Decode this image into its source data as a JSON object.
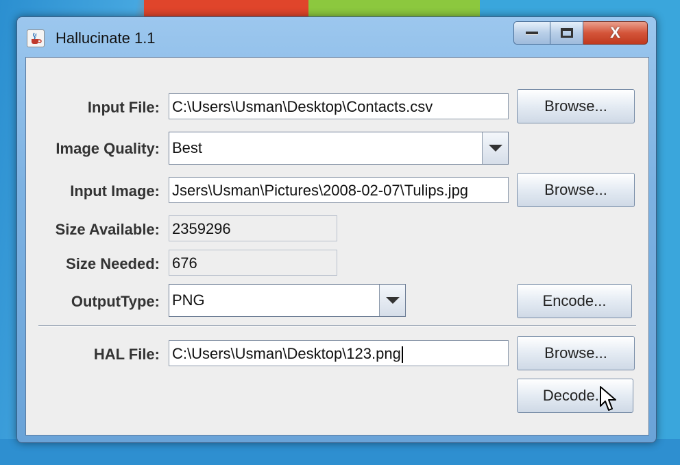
{
  "window": {
    "title": "Hallucinate 1.1",
    "controls": {
      "minimize": "minimize",
      "maximize": "maximize",
      "close": "X"
    }
  },
  "form": {
    "input_file": {
      "label": "Input File:",
      "value": "C:\\Users\\Usman\\Desktop\\Contacts.csv",
      "browse": "Browse..."
    },
    "image_quality": {
      "label": "Image Quality:",
      "selected": "Best"
    },
    "input_image": {
      "label": "Input Image:",
      "value": "Jsers\\Usman\\Pictures\\2008-02-07\\Tulips.jpg",
      "browse": "Browse..."
    },
    "size_available": {
      "label": "Size Available:",
      "value": "2359296"
    },
    "size_needed": {
      "label": "Size Needed:",
      "value": "676"
    },
    "output_type": {
      "label": "OutputType:",
      "selected": "PNG",
      "encode": "Encode..."
    },
    "hal_file": {
      "label": "HAL File:",
      "value": "C:\\Users\\Usman\\Desktop\\123.png",
      "browse": "Browse...",
      "decode": "Decode..."
    }
  },
  "colors": {
    "titlebar": "#7db2e2",
    "close_button": "#d4553a",
    "panel": "#eeeeee"
  },
  "icons": {
    "app": "java-cup-icon",
    "cursor": "mouse-pointer-icon"
  }
}
